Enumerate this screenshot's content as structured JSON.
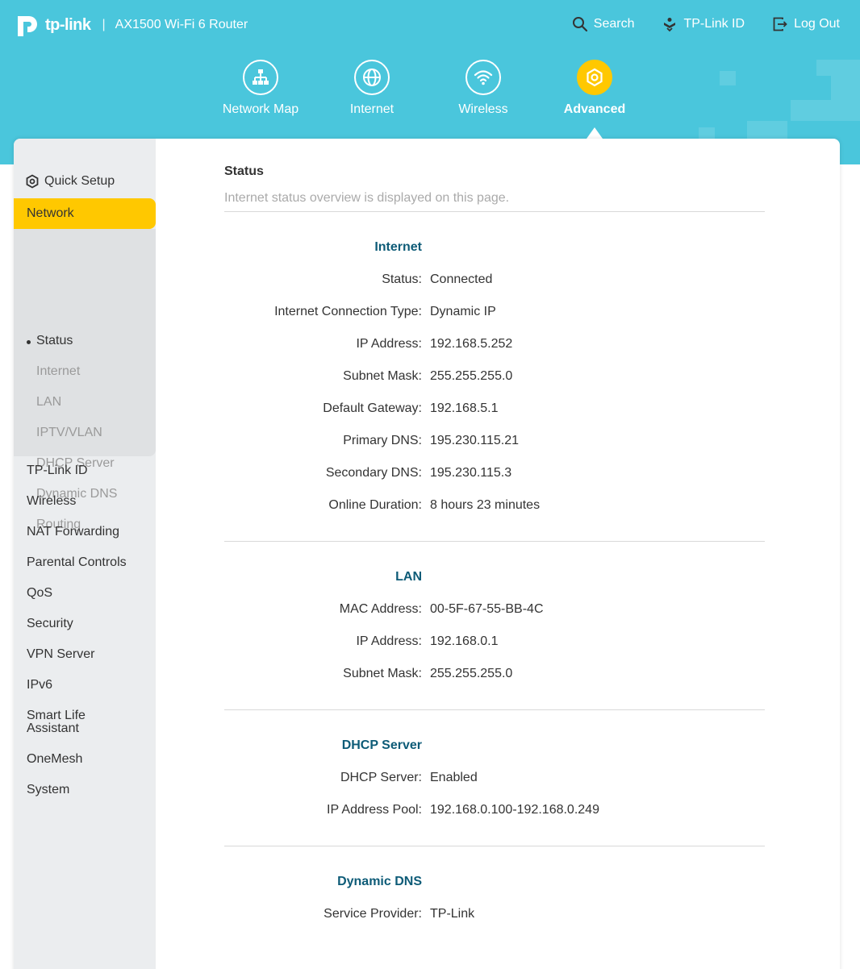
{
  "header": {
    "brand": "tp-link",
    "separator": "|",
    "model": "AX1500 Wi-Fi 6 Router",
    "actions": [
      {
        "label": "Search",
        "icon": "search-icon"
      },
      {
        "label": "TP-Link ID",
        "icon": "tplink-id-icon"
      },
      {
        "label": "Log Out",
        "icon": "logout-icon"
      }
    ]
  },
  "nav": [
    {
      "label": "Network Map",
      "icon": "network-map-icon",
      "active": false
    },
    {
      "label": "Internet",
      "icon": "globe-icon",
      "active": false
    },
    {
      "label": "Wireless",
      "icon": "wifi-icon",
      "active": false
    },
    {
      "label": "Advanced",
      "icon": "gear-icon",
      "active": true
    }
  ],
  "sidebar": {
    "quick_setup": "Quick Setup",
    "network": "Network",
    "submenu": [
      "Status",
      "Internet",
      "LAN",
      "IPTV/VLAN",
      "DHCP Server",
      "Dynamic DNS",
      "Routing"
    ],
    "active_submenu": "Status",
    "items": [
      "TP-Link ID",
      "Wireless",
      "NAT Forwarding",
      "Parental Controls",
      "QoS",
      "Security",
      "VPN Server",
      "IPv6",
      "Smart Life Assistant",
      "OneMesh",
      "System"
    ]
  },
  "page": {
    "title": "Status",
    "description": "Internet status overview is displayed on this page."
  },
  "sections": {
    "internet": {
      "title": "Internet",
      "rows": [
        {
          "label": "Status:",
          "value": "Connected"
        },
        {
          "label": "Internet Connection Type:",
          "value": "Dynamic IP"
        },
        {
          "label": "IP Address:",
          "value": "192.168.5.252"
        },
        {
          "label": "Subnet Mask:",
          "value": "255.255.255.0"
        },
        {
          "label": "Default Gateway:",
          "value": "192.168.5.1"
        },
        {
          "label": "Primary DNS:",
          "value": "195.230.115.21"
        },
        {
          "label": "Secondary DNS:",
          "value": "195.230.115.3"
        },
        {
          "label": "Online Duration:",
          "value": "8 hours 23 minutes"
        }
      ]
    },
    "lan": {
      "title": "LAN",
      "rows": [
        {
          "label": "MAC Address:",
          "value": "00-5F-67-55-BB-4C"
        },
        {
          "label": "IP Address:",
          "value": "192.168.0.1"
        },
        {
          "label": "Subnet Mask:",
          "value": "255.255.255.0"
        }
      ]
    },
    "dhcp": {
      "title": "DHCP Server",
      "rows": [
        {
          "label": "DHCP Server:",
          "value": "Enabled"
        },
        {
          "label": "IP Address Pool:",
          "value": "192.168.0.100-192.168.0.249"
        }
      ]
    },
    "ddns": {
      "title": "Dynamic DNS",
      "rows": [
        {
          "label": "Service Provider:",
          "value": "TP-Link"
        }
      ]
    }
  },
  "colors": {
    "header_bg": "#4ac6dc",
    "accent_yellow": "#ffc800",
    "section_title": "#0d5b77",
    "sidebar_bg": "#ebedef"
  }
}
